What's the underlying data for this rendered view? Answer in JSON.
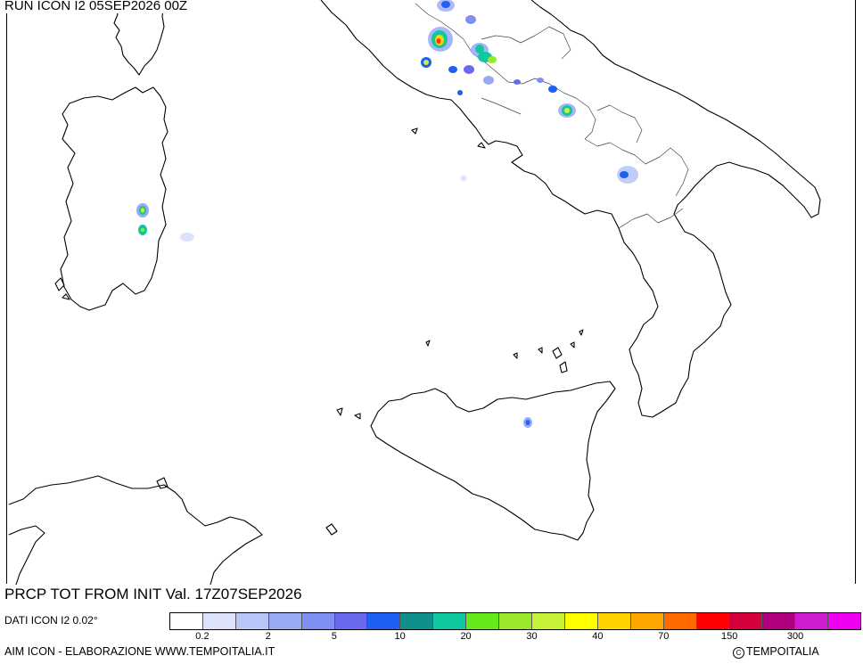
{
  "header": {
    "run_title": "RUN ICON I2 05SEP2026 00Z"
  },
  "footer": {
    "prcp_title": "PRCP TOT FROM INIT Val. 17Z07SEP2026",
    "dati_label": "DATI ICON I2 0.02°",
    "credit_left": "AIM ICON - ELABORAZIONE WWW.TEMPOITALIA.IT",
    "credit_right": "TEMPOITALIA"
  },
  "legend": {
    "colors": [
      "#ffffff",
      "#dde2fb",
      "#bac6f8",
      "#98aaf5",
      "#7f8ef2",
      "#6a6aee",
      "#1f5ff2",
      "#118f8c",
      "#10c8a0",
      "#66e81c",
      "#9ae82c",
      "#c8f23a",
      "#ffff00",
      "#ffd200",
      "#ffa500",
      "#ff6a00",
      "#ff0000",
      "#d4003c",
      "#b00080",
      "#d01cd0",
      "#f000f0"
    ],
    "ticks": [
      {
        "label": "0.2",
        "boundary": 1
      },
      {
        "label": "2",
        "boundary": 3
      },
      {
        "label": "5",
        "boundary": 5
      },
      {
        "label": "10",
        "boundary": 7
      },
      {
        "label": "20",
        "boundary": 9
      },
      {
        "label": "30",
        "boundary": 11
      },
      {
        "label": "40",
        "boundary": 13
      },
      {
        "label": "70",
        "boundary": 15
      },
      {
        "label": "150",
        "boundary": 17
      },
      {
        "label": "300",
        "boundary": 19
      }
    ]
  }
}
